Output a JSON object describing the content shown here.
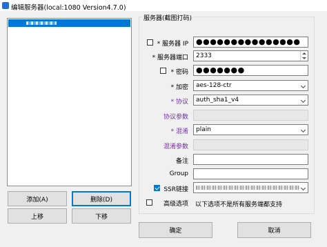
{
  "window": {
    "title": "编辑服务器(local:1080 Version4.7.0)"
  },
  "server_list": {
    "selected_item": ""
  },
  "left_buttons": {
    "add": "添加(A)",
    "delete": "删除(D)",
    "move_up": "上移",
    "move_down": "下移"
  },
  "group": {
    "title": "服务器(截图打码)"
  },
  "form": {
    "server_ip": {
      "label": "* 服务器 IP",
      "value": "●●●●●●●●●●●●●●●",
      "checked": false
    },
    "port": {
      "label": "* 服务器端口",
      "value": "2333"
    },
    "password": {
      "label": "* 密码",
      "value": "●●●●●●●",
      "checked": false
    },
    "encryption": {
      "label": "* 加密",
      "value": "aes-128-ctr"
    },
    "protocol": {
      "label": "* 协议",
      "value": "auth_sha1_v4"
    },
    "protocol_param": {
      "label": "协议参数",
      "value": ""
    },
    "obfs": {
      "label": "* 混淆",
      "value": "plain"
    },
    "obfs_param": {
      "label": "混淆参数",
      "value": ""
    },
    "remarks": {
      "label": "备注",
      "value": ""
    },
    "group": {
      "label": "Group",
      "value": ""
    },
    "ssr_link": {
      "label": "SSR链接",
      "checked": true,
      "value": ""
    },
    "advanced": {
      "label": "高级选项",
      "checked": false,
      "note": "以下选项不是所有服务端都支持"
    }
  },
  "dialog_buttons": {
    "ok": "确定",
    "cancel": "取消"
  },
  "colors": {
    "accent": "#0078d7",
    "purple_label": "#7030a0"
  }
}
